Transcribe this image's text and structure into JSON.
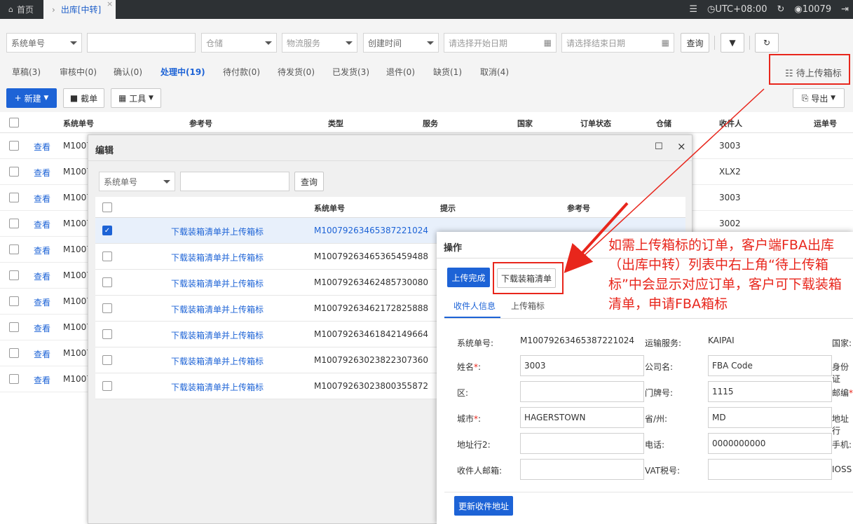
{
  "topbar": {
    "home_label": "首页",
    "active_tab": "出库[中转]",
    "timezone": "UTC+08:00",
    "user_id": "10079"
  },
  "filters": {
    "field_select": "系统单号",
    "warehouse": "仓储",
    "logistics": "物流服务",
    "date_type": "创建时间",
    "start_placeholder": "请选择开始日期",
    "end_placeholder": "请选择结束日期",
    "query_label": "查询"
  },
  "status_tabs": [
    {
      "label": "草稿(3)"
    },
    {
      "label": "审核中(0)"
    },
    {
      "label": "确认(0)"
    },
    {
      "label": "处理中(19)"
    },
    {
      "label": "待付款(0)"
    },
    {
      "label": "待发货(0)"
    },
    {
      "label": "已发货(3)"
    },
    {
      "label": "退件(0)"
    },
    {
      "label": "缺货(1)"
    },
    {
      "label": "取消(4)"
    }
  ],
  "pending_label": "待上传箱标",
  "toolbar": {
    "new_label": "新建",
    "cut_label": "截单",
    "tools_label": "工具",
    "export_label": "导出"
  },
  "grid": {
    "headers": [
      "系统单号",
      "参考号",
      "类型",
      "服务",
      "国家",
      "订单状态",
      "仓储",
      "收件人",
      "运单号"
    ],
    "view_label": "查看",
    "rows": [
      {
        "id": "M1007",
        "recipient": "3003"
      },
      {
        "id": "M1007",
        "recipient": "XLX2"
      },
      {
        "id": "M1007",
        "recipient": "3003"
      },
      {
        "id": "M1007",
        "recipient": "3002"
      },
      {
        "id": "M1007",
        "recipient": ""
      },
      {
        "id": "M1007",
        "recipient": ""
      },
      {
        "id": "M1007",
        "recipient": ""
      },
      {
        "id": "M1007",
        "recipient": ""
      },
      {
        "id": "M1007",
        "recipient": ""
      },
      {
        "id": "M1007",
        "recipient": ""
      }
    ]
  },
  "edit_dialog": {
    "title": "编辑",
    "field_select": "系统单号",
    "query_label": "查询",
    "headers": [
      "系统单号",
      "提示",
      "参考号"
    ],
    "action_label": "下载装箱清单并上传箱标",
    "rows": [
      {
        "id": "M10079263465387221024",
        "checked": true
      },
      {
        "id": "M10079263465365459488",
        "checked": false
      },
      {
        "id": "M10079263462485730080",
        "checked": false
      },
      {
        "id": "M10079263462172825888",
        "checked": false
      },
      {
        "id": "M10079263461842149664",
        "checked": false
      },
      {
        "id": "M10079263023822307360",
        "checked": false
      },
      {
        "id": "M10079263023800355872",
        "checked": false
      }
    ]
  },
  "op_dialog": {
    "title": "操作",
    "upload_done_label": "上传完成",
    "download_list_label": "下载装箱清单",
    "tabs": [
      "收件人信息",
      "上传箱标"
    ],
    "labels": {
      "sys_no": "系统单号:",
      "ship_service": "运输服务:",
      "country": "国家:",
      "name": "姓名",
      "company": "公司名:",
      "id_card": "身份证",
      "district": "区:",
      "house_no": "门牌号:",
      "postcode": "邮编",
      "city": "城市",
      "province": "省/州:",
      "address1": "地址行",
      "address2": "地址行2:",
      "phone": "电话:",
      "mobile": "手机:",
      "email": "收件人邮箱:",
      "vat": "VAT税号:",
      "ioss": "IOSS"
    },
    "values": {
      "sys_no": "M10079263465387221024",
      "ship_service": "KAIPAI",
      "name": "3003",
      "company": "FBA Code",
      "district": "",
      "house_no": "1115",
      "city": "HAGERSTOWN",
      "province": "MD",
      "address2": "",
      "phone": "0000000000",
      "email": "",
      "vat": ""
    },
    "update_address_label": "更新收件地址"
  },
  "annotation": "如需上传箱标的订单，客户端FBA出库（出库中转）列表中右上角“待上传箱标”中会显示对应订单，客户可下载装箱清单，申请FBA箱标",
  "colors": {
    "accent": "#1d63d6",
    "annotation": "#e8261c",
    "topbar": "#2d3134"
  }
}
